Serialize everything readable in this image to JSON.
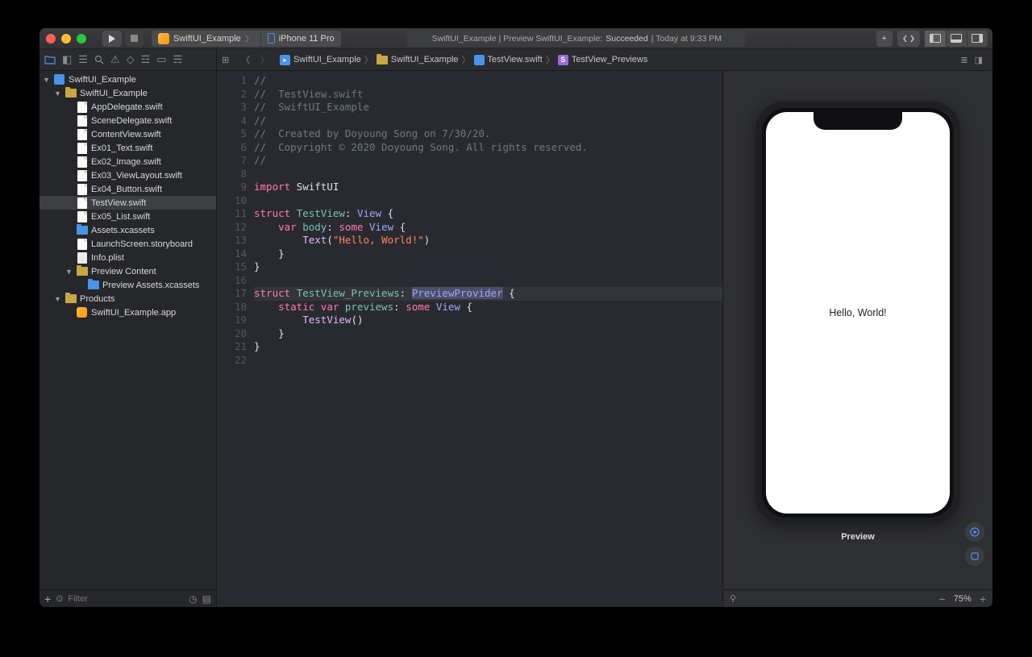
{
  "toolbar": {
    "scheme_target": "SwiftUI_Example",
    "scheme_device": "iPhone 11 Pro",
    "activity_prefix": "SwiftUI_Example | Preview SwiftUI_Example:",
    "activity_status": "Succeeded",
    "activity_suffix": "| Today at 9:33 PM"
  },
  "jumpbar": {
    "project": "SwiftUI_Example",
    "folder": "SwiftUI_Example",
    "file": "TestView.swift",
    "symbol": "TestView_Previews"
  },
  "navigator": {
    "root": "SwiftUI_Example",
    "group": "SwiftUI_Example",
    "files": [
      "AppDelegate.swift",
      "SceneDelegate.swift",
      "ContentView.swift",
      "Ex01_Text.swift",
      "Ex02_Image.swift",
      "Ex03_ViewLayout.swift",
      "Ex04_Button.swift",
      "TestView.swift",
      "Ex05_List.swift"
    ],
    "selected": "TestView.swift",
    "assets": "Assets.xcassets",
    "launchscreen": "LaunchScreen.storyboard",
    "infoplist": "Info.plist",
    "preview_group": "Preview Content",
    "preview_assets": "Preview Assets.xcassets",
    "products_group": "Products",
    "product": "SwiftUI_Example.app",
    "filter_placeholder": "Filter"
  },
  "editor": {
    "lines": 22,
    "highlighted_line": 17,
    "code_comments": {
      "l1": "//",
      "l2": "//  TestView.swift",
      "l3": "//  SwiftUI_Example",
      "l4": "//",
      "l5": "//  Created by Doyoung Song on 7/30/20.",
      "l6": "//  Copyright © 2020 Doyoung Song. All rights reserved.",
      "l7": "//"
    },
    "tokens": {
      "import": "import",
      "swiftui": "SwiftUI",
      "struct": "struct",
      "testview": "TestView",
      "view": "View",
      "var": "var",
      "body": "body",
      "some": "some",
      "text": "Text",
      "hello": "\"Hello, World!\"",
      "previews_struct": "TestView_Previews",
      "preview_provider": "PreviewProvider",
      "static": "static",
      "previews": "previews",
      "testview_call": "TestView"
    }
  },
  "preview": {
    "screen_text": "Hello, World!",
    "label": "Preview",
    "zoom": "75%"
  }
}
